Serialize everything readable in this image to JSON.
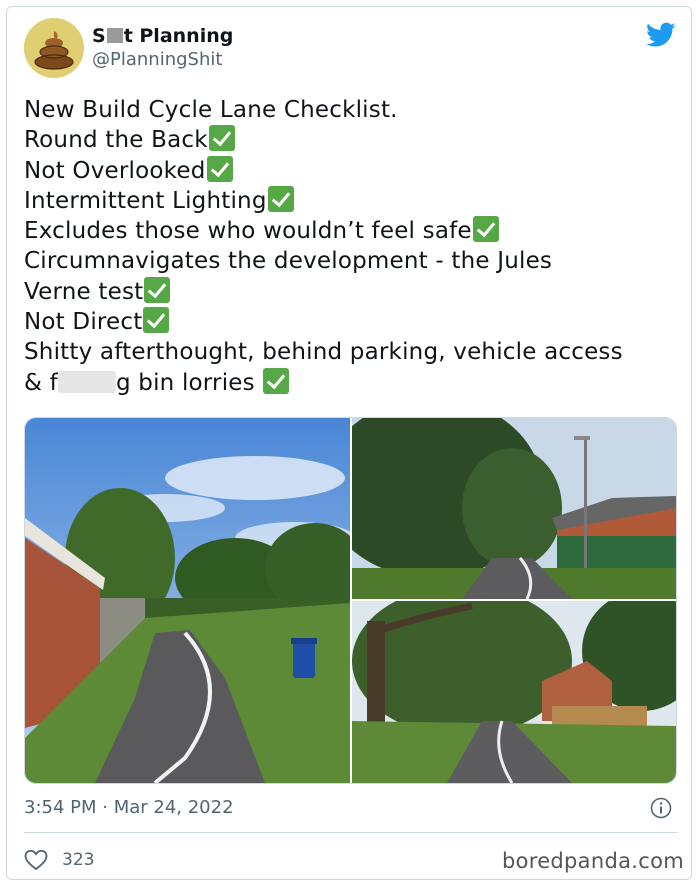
{
  "tweet": {
    "display_name_start": "S",
    "display_name_end": "t Planning",
    "handle": "@PlanningShit",
    "lines": {
      "l1": "New Build Cycle Lane Checklist.",
      "l2": "Round the Back",
      "l3": "Not Overlooked",
      "l4": "Intermittent Lighting",
      "l5": "Excludes those who wouldn’t feel safe",
      "l6": "Circumnavigates the development - the Jules",
      "l7": "Verne test",
      "l8": "Not Direct",
      "l9": "Shitty afterthought, behind parking, vehicle access",
      "l10a": "& f",
      "l10b": "g bin lorries "
    },
    "timestamp": "3:54 PM · Mar 24, 2022",
    "like_count": "323"
  },
  "icons": {
    "brand": "twitter-bird-icon",
    "check": "check-mark-icon",
    "info": "info-icon",
    "like": "heart-icon"
  },
  "colors": {
    "twitter_blue": "#1d9bf0",
    "check_green": "#56a745",
    "muted_text": "#536471"
  },
  "watermark": "boredpanda.com"
}
